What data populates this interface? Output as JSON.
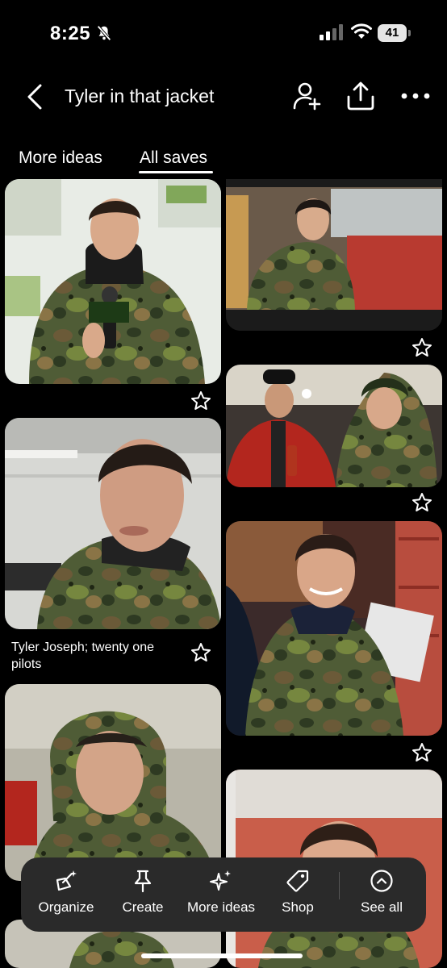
{
  "status": {
    "time": "8:25",
    "battery": "41",
    "icons": [
      "bell-slash-icon",
      "cellular-signal-icon",
      "wifi-icon",
      "battery-icon"
    ]
  },
  "header": {
    "title": "Tyler in that jacket",
    "icons": [
      "chevron-left-icon",
      "add-collaborator-icon",
      "share-icon",
      "more-options-icon"
    ]
  },
  "tabs": [
    {
      "label": "More ideas",
      "selected": false
    },
    {
      "label": "All saves",
      "selected": true
    }
  ],
  "pins": [
    {
      "caption": ""
    },
    {
      "caption": ""
    },
    {
      "caption": "Tyler Joseph; twenty one pilots"
    },
    {
      "caption": ""
    },
    {
      "caption": ""
    },
    {
      "caption": ""
    }
  ],
  "toolbar": {
    "items": [
      {
        "label": "Organize",
        "icon": "organize-icon"
      },
      {
        "label": "Create",
        "icon": "pin-icon"
      },
      {
        "label": "More ideas",
        "icon": "sparkle-icon"
      },
      {
        "label": "Shop",
        "icon": "tag-icon"
      },
      {
        "label": "See all",
        "icon": "chevron-up-circle-icon"
      }
    ]
  },
  "colors": {
    "background": "#000000",
    "toolbar": "#2a2a2a",
    "text": "#ffffff",
    "camo_green": "#4a5a32",
    "camo_brown": "#6b5a3a"
  }
}
